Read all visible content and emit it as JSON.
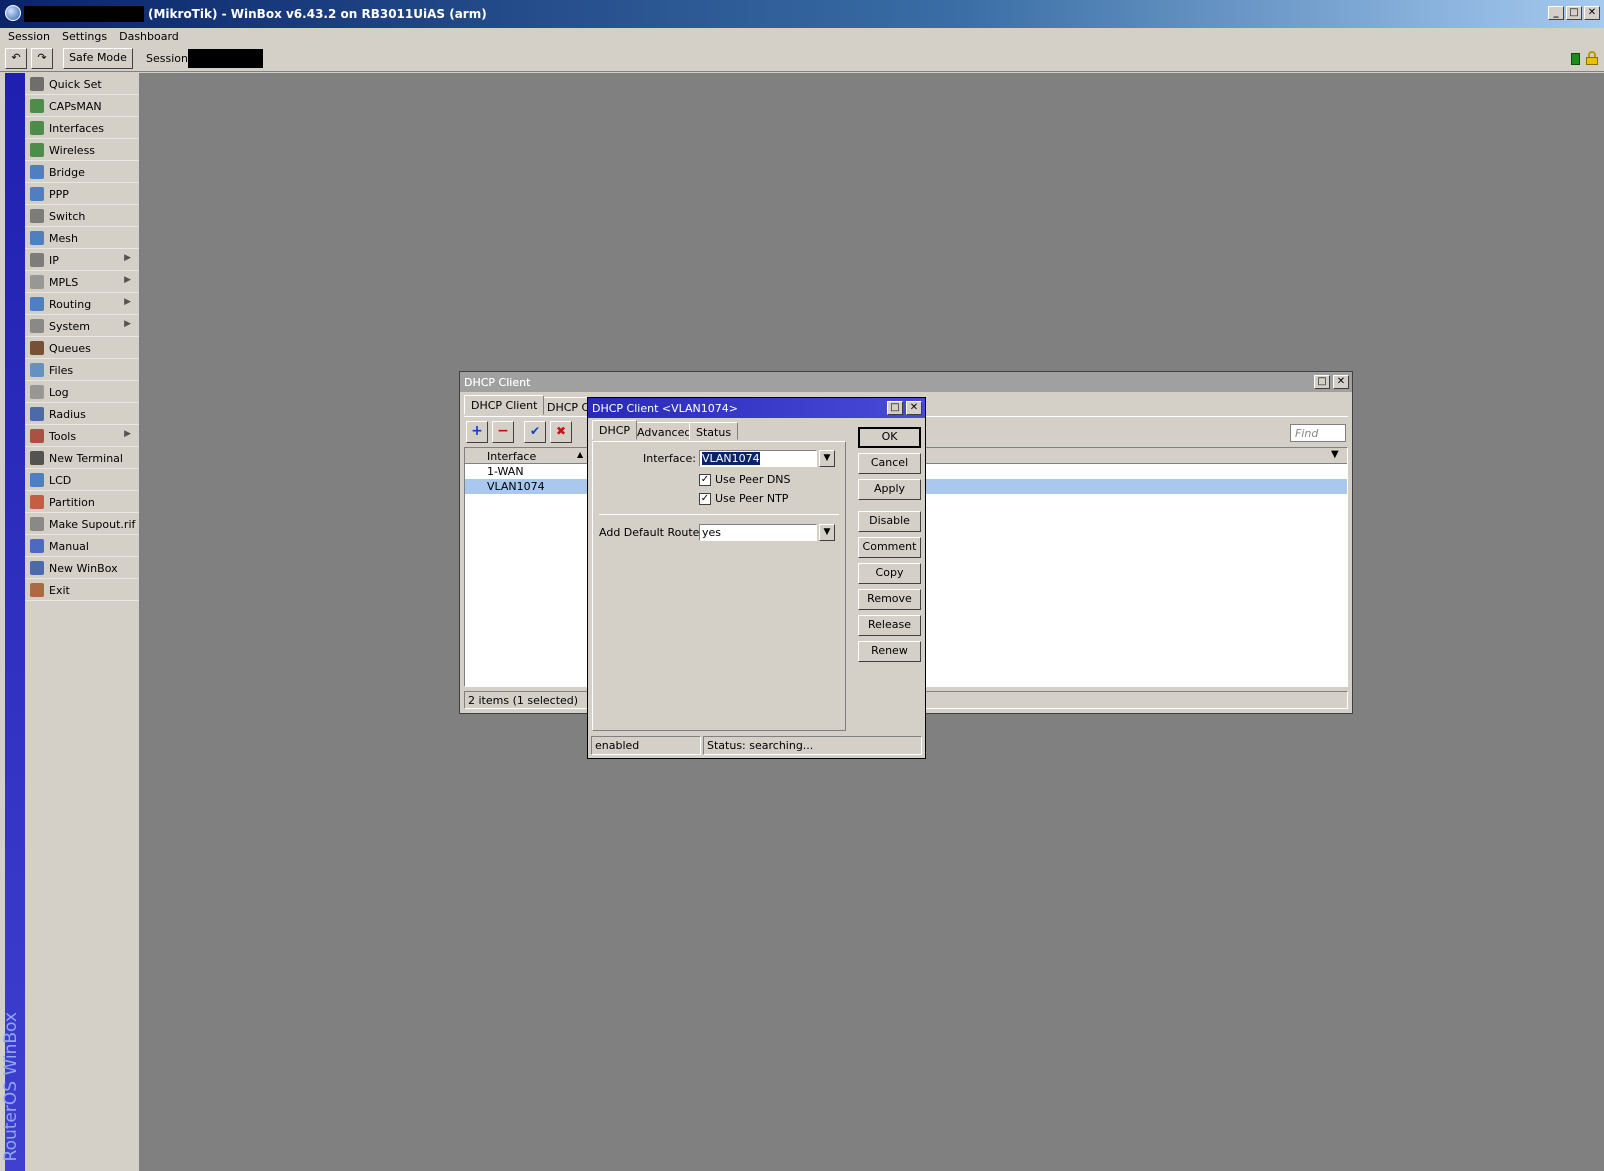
{
  "app": {
    "title": "(MikroTik) - WinBox v6.43.2 on RB3011UiAS (arm)",
    "menu": [
      "Session",
      "Settings",
      "Dashboard"
    ],
    "toolbar": {
      "safe_mode": "Safe Mode",
      "session_label": "Session:"
    },
    "brand": "RouterOS WinBox"
  },
  "sidebar": {
    "items": [
      {
        "label": "Quick Set",
        "icon": "quick-set-icon",
        "submenu": false
      },
      {
        "label": "CAPsMAN",
        "icon": "capsman-icon",
        "submenu": false
      },
      {
        "label": "Interfaces",
        "icon": "interfaces-icon",
        "submenu": false
      },
      {
        "label": "Wireless",
        "icon": "wireless-icon",
        "submenu": false
      },
      {
        "label": "Bridge",
        "icon": "bridge-icon",
        "submenu": false
      },
      {
        "label": "PPP",
        "icon": "ppp-icon",
        "submenu": false
      },
      {
        "label": "Switch",
        "icon": "switch-icon",
        "submenu": false
      },
      {
        "label": "Mesh",
        "icon": "mesh-icon",
        "submenu": false
      },
      {
        "label": "IP",
        "icon": "ip-icon",
        "submenu": true
      },
      {
        "label": "MPLS",
        "icon": "mpls-icon",
        "submenu": true
      },
      {
        "label": "Routing",
        "icon": "routing-icon",
        "submenu": true
      },
      {
        "label": "System",
        "icon": "system-icon",
        "submenu": true
      },
      {
        "label": "Queues",
        "icon": "queues-icon",
        "submenu": false
      },
      {
        "label": "Files",
        "icon": "files-icon",
        "submenu": false
      },
      {
        "label": "Log",
        "icon": "log-icon",
        "submenu": false
      },
      {
        "label": "Radius",
        "icon": "radius-icon",
        "submenu": false
      },
      {
        "label": "Tools",
        "icon": "tools-icon",
        "submenu": true
      },
      {
        "label": "New Terminal",
        "icon": "terminal-icon",
        "submenu": false
      },
      {
        "label": "LCD",
        "icon": "lcd-icon",
        "submenu": false
      },
      {
        "label": "Partition",
        "icon": "partition-icon",
        "submenu": false
      },
      {
        "label": "Make Supout.rif",
        "icon": "supout-icon",
        "submenu": false
      },
      {
        "label": "Manual",
        "icon": "manual-icon",
        "submenu": false
      },
      {
        "label": "New WinBox",
        "icon": "winbox-icon",
        "submenu": false
      },
      {
        "label": "Exit",
        "icon": "exit-icon",
        "submenu": false
      }
    ]
  },
  "dhcp_window": {
    "title": "DHCP Client",
    "tabs": [
      "DHCP Client",
      "DHCP Clier"
    ],
    "find_placeholder": "Find",
    "columns": [
      "Interface"
    ],
    "rows": [
      {
        "interface": "1-WAN",
        "selected": false
      },
      {
        "interface": "VLAN1074",
        "selected": true
      }
    ],
    "status": "2 items (1 selected)"
  },
  "edit_dialog": {
    "title": "DHCP Client <VLAN1074>",
    "tabs": [
      "DHCP",
      "Advanced",
      "Status"
    ],
    "interface_label": "Interface:",
    "interface_value": "VLAN1074",
    "use_peer_dns_label": "Use Peer DNS",
    "use_peer_dns": true,
    "use_peer_ntp_label": "Use Peer NTP",
    "use_peer_ntp": true,
    "default_route_label": "Add Default Route:",
    "default_route_value": "yes",
    "buttons": {
      "ok": "OK",
      "cancel": "Cancel",
      "apply": "Apply",
      "disable": "Disable",
      "comment": "Comment",
      "copy": "Copy",
      "remove": "Remove",
      "release": "Release",
      "renew": "Renew"
    },
    "status_left": "enabled",
    "status_right": "Status: searching..."
  }
}
